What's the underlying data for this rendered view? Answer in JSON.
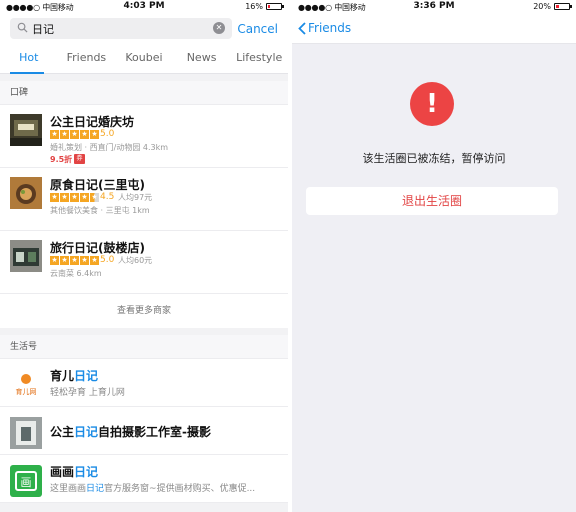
{
  "left": {
    "status": {
      "carrier": "●●●●○ 中国移动",
      "time": "4:03 PM",
      "battery": "16%",
      "battery_level": 0.16
    },
    "search": {
      "value": "日记",
      "cancel_label": "Cancel"
    },
    "tabs": [
      "Hot",
      "Friends",
      "Koubei",
      "News",
      "Lifestyle"
    ],
    "koubei_section": {
      "title": "口碑",
      "merchants": [
        {
          "name": "公主日记婚庆坊",
          "score": "5.0",
          "avg": "",
          "meta": "婚礼策划 · 西直门/动物园 4.3km",
          "deal": "9.5折",
          "deal_tag": "券",
          "rating": 5
        },
        {
          "name": "原食日记(三里屯)",
          "score": "4.5",
          "avg": "人均97元",
          "meta": "其他餐饮美食 · 三里屯 1km",
          "deal": "",
          "deal_tag": "",
          "rating": 4.5
        },
        {
          "name": "旅行日记(鼓楼店)",
          "score": "5.0",
          "avg": "人均60元",
          "meta": "云南菜 6.4km",
          "deal": "",
          "deal_tag": "",
          "rating": 5
        }
      ],
      "more_label": "查看更多商家"
    },
    "accounts_section": {
      "title": "生活号",
      "accounts": [
        {
          "name_pre": "育儿",
          "name_hl": "日记",
          "name_post": "",
          "desc_pre": "轻松孕育 上育儿网",
          "desc_hl": "",
          "desc_post": ""
        },
        {
          "name_pre": "公主",
          "name_hl": "日记",
          "name_post": "自拍摄影工作室-摄影",
          "desc_pre": "",
          "desc_hl": "",
          "desc_post": ""
        },
        {
          "name_pre": "画画",
          "name_hl": "日记",
          "name_post": "",
          "desc_pre": "这里画画",
          "desc_hl": "日记",
          "desc_post": "官方服务窗~提供画材购买、优惠促..."
        }
      ]
    }
  },
  "right": {
    "status": {
      "carrier": "●●●●○ 中国移动",
      "time": "3:36 PM",
      "battery": "20%",
      "battery_level": 0.2
    },
    "back_label": "Friends",
    "frozen_message": "该生活圈已被冻结，暂停访问",
    "exit_label": "退出生活圈"
  },
  "colors": {
    "accent": "#1a8be5",
    "alert": "#ec4444",
    "star": "#f5a623"
  }
}
